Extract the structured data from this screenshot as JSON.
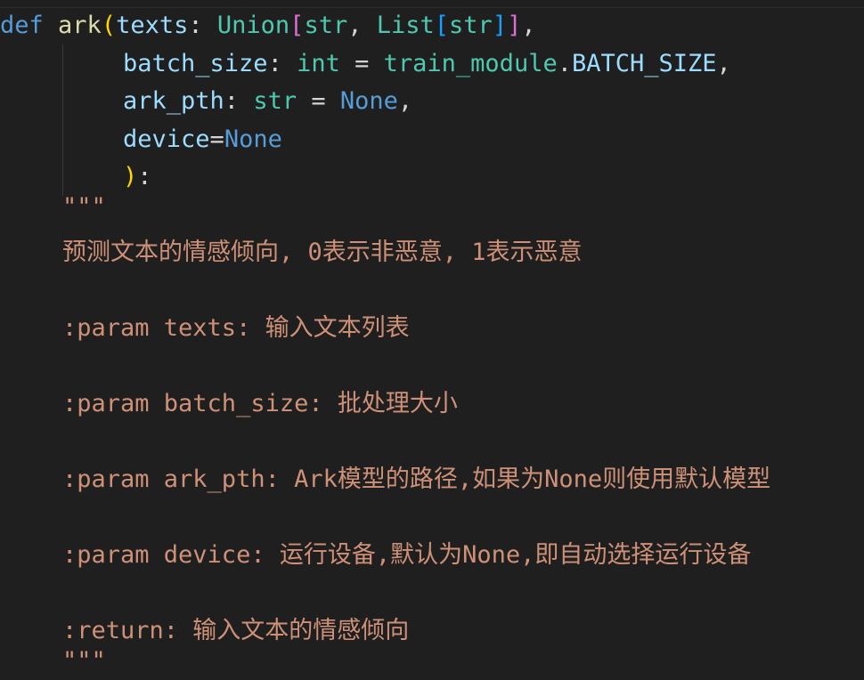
{
  "code": {
    "l1": {
      "def": "def",
      "fn": "ark",
      "open": "(",
      "p1": "texts",
      "colon": ": ",
      "union": "Union",
      "lb1": "[",
      "str1": "str",
      "comma1": ", ",
      "list": "List",
      "lb2": "[",
      "str2": "str",
      "rb2": "]",
      "rb1": "]",
      "comma2": ","
    },
    "l2": {
      "p": "batch_size",
      "colon": ": ",
      "type": "int",
      "eq": " = ",
      "mod": "train_module",
      "dot": ".",
      "const": "BATCH_SIZE",
      "comma": ","
    },
    "l3": {
      "p": "ark_pth",
      "colon": ": ",
      "type": "str",
      "eq": " = ",
      "val": "None",
      "comma": ","
    },
    "l4": {
      "p": "device",
      "eq": "=",
      "val": "None"
    },
    "l5": {
      "close": ")",
      "colon": ":"
    },
    "doc": [
      "\"\"\"",
      "预测文本的情感倾向, 0表示非恶意, 1表示恶意",
      ":param texts: 输入文本列表",
      ":param batch_size: 批处理大小",
      ":param ark_pth: Ark模型的路径,如果为None则使用默认模型",
      ":param device: 运行设备,默认为None,即自动选择运行设备",
      ":return: 输入文本的情感倾向",
      "\"\"\""
    ]
  },
  "colors": {
    "background": "#1f1f1f",
    "keyword": "#569cd6",
    "function": "#dcdcaa",
    "parameter": "#9cdcfe",
    "type": "#4ec9b0",
    "string": "#ce9178"
  }
}
